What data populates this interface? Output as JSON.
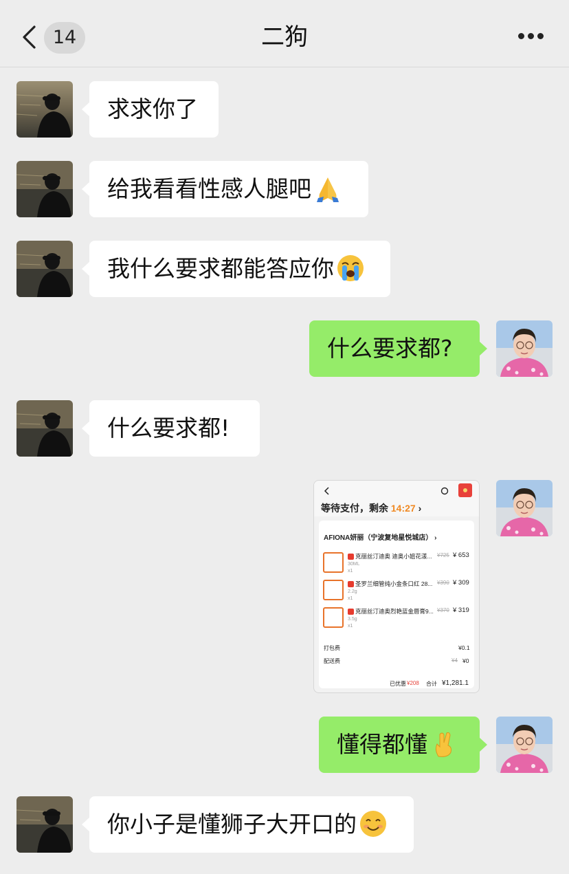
{
  "header": {
    "back_count": "14",
    "title": "二狗"
  },
  "messages": {
    "m1": "求求你了",
    "m2": "给我看看性感人腿吧",
    "m3": "我什么要求都能答应你",
    "m4": "什么要求都?",
    "m5": "什么要求都!",
    "m7": "懂得都懂",
    "m8": "你小子是懂狮子大开口的"
  },
  "order": {
    "status_prefix": "等待支付，剩余",
    "timer": "14:27",
    "store": "AFIONA妍丽（宁波复地星悦城店）",
    "items": [
      {
        "name": "克丽丝汀迪奥 迪奥小姐花漾...",
        "spec": "30ML",
        "qty": "x1",
        "old_price": "¥725",
        "price": "¥ 653"
      },
      {
        "name": "圣罗兰细管纯小金条口红 28...",
        "spec": "2.2g",
        "qty": "x1",
        "old_price": "¥390",
        "price": "¥ 309"
      },
      {
        "name": "克丽丝汀迪奥烈艳蓝金唇膏9...",
        "spec": "3.5g",
        "qty": "x1",
        "old_price": "¥370",
        "price": "¥ 319"
      }
    ],
    "packing_label": "打包费",
    "packing_value": "¥0.1",
    "delivery_label": "配送费",
    "delivery_old": "¥4",
    "delivery_value": "¥0",
    "discount_label": "已优惠",
    "discount_value": "¥208",
    "total_label": "合计",
    "total_value": "¥1,281.1"
  },
  "icons": [
    "back-chevron-icon",
    "more-dots-icon",
    "folded-hands-emoji",
    "crying-face-emoji",
    "crossed-fingers-emoji",
    "smiling-face-emoji"
  ],
  "colors": {
    "background": "#ededed",
    "incoming_bubble": "#ffffff",
    "outgoing_bubble": "#95ec69",
    "timer_accent": "#f08a24",
    "discount_accent": "#e6433a"
  }
}
